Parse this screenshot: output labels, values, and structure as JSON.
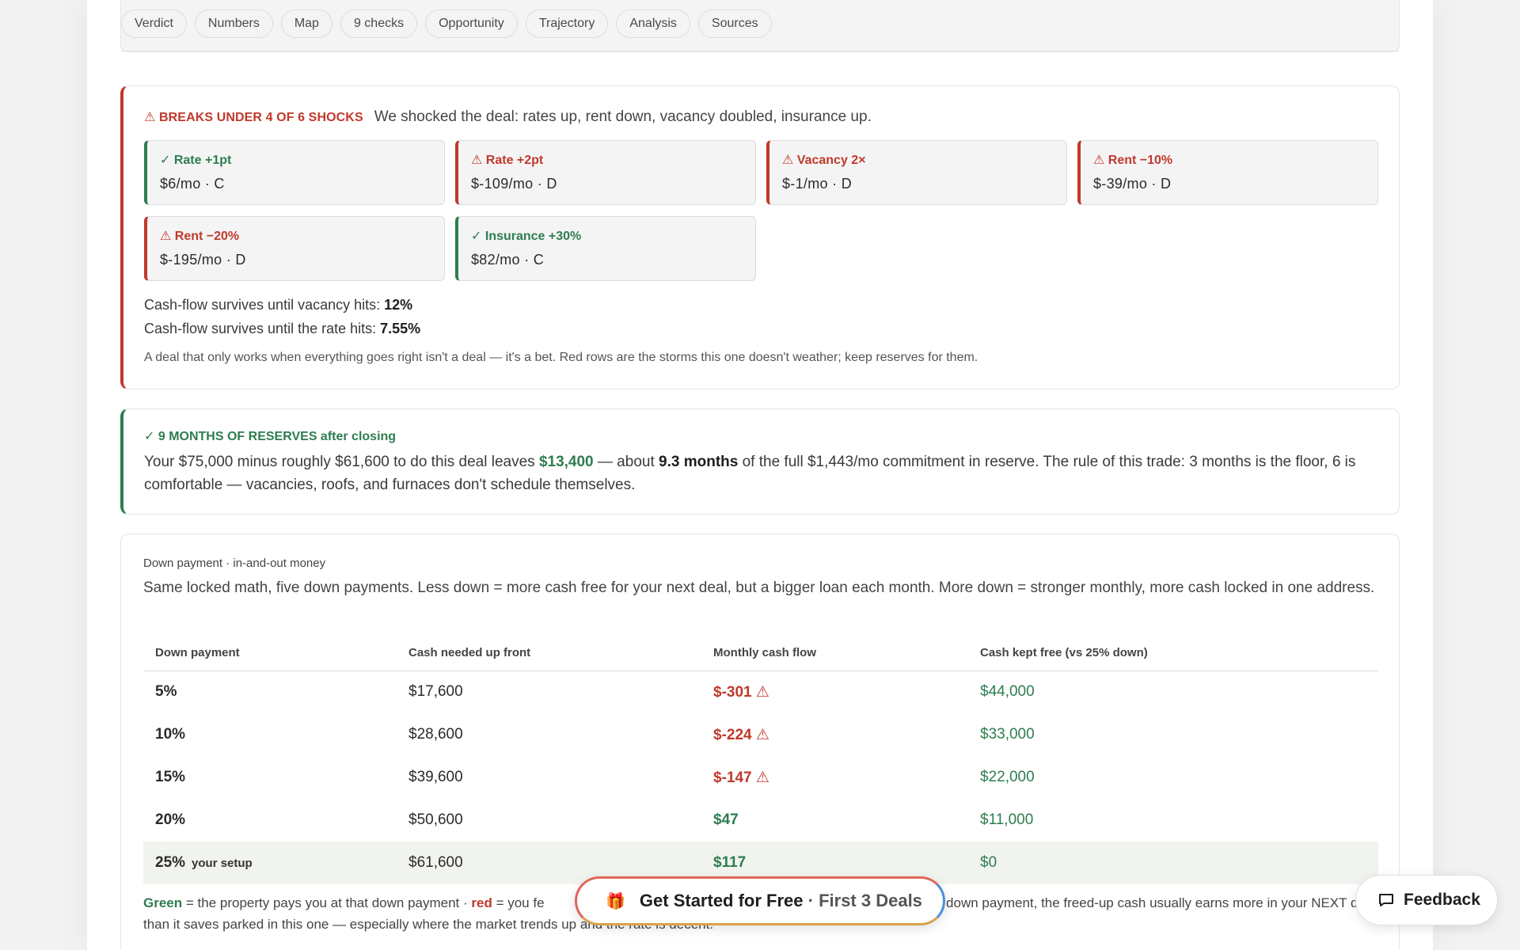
{
  "nav": {
    "pills": [
      "Verdict",
      "Numbers",
      "Map",
      "9 checks",
      "Opportunity",
      "Trajectory",
      "Analysis",
      "Sources"
    ]
  },
  "shocks": {
    "tag": "⚠ BREAKS UNDER 4 OF 6 SHOCKS",
    "lead": "We shocked the deal: rates up, rent down, vacancy doubled, insurance up.",
    "tiles": [
      {
        "label": "✓ Rate +1pt",
        "value": "$6/mo · C",
        "status": "ok"
      },
      {
        "label": "⚠ Rate +2pt",
        "value": "$-109/mo · D",
        "status": "bad"
      },
      {
        "label": "⚠ Vacancy 2×",
        "value": "$-1/mo · D",
        "status": "bad"
      },
      {
        "label": "⚠ Rent −10%",
        "value": "$-39/mo · D",
        "status": "bad"
      },
      {
        "label": "⚠ Rent −20%",
        "value": "$-195/mo · D",
        "status": "bad"
      },
      {
        "label": "✓ Insurance +30%",
        "value": "$82/mo · C",
        "status": "ok"
      }
    ],
    "survive_vacancy_label": "Cash-flow survives until vacancy hits:",
    "survive_vacancy_value": "12%",
    "survive_rate_label": "Cash-flow survives until the rate hits:",
    "survive_rate_value": "7.55%",
    "note": "A deal that only works when everything goes right isn't a deal — it's a bet. Red rows are the storms this one doesn't weather; keep reserves for them."
  },
  "reserves": {
    "tag": "✓ 9 MONTHS OF RESERVES after closing",
    "text_1": "Your $75,000 minus roughly $61,600 to do this deal leaves ",
    "amount": "$13,400",
    "text_2": " — about ",
    "months": "9.3 months",
    "text_3": " of the full $1,443/mo commitment in reserve. The rule of this trade: 3 months is the floor, 6 is comfortable — vacancies, roofs, and furnaces don't schedule themselves."
  },
  "down_payment": {
    "kicker": "Down payment · in-and-out money",
    "lead": "Same locked math, five down payments. Less down = more cash free for your next deal, but a bigger loan each month. More down = stronger monthly, more cash locked in one address.",
    "headers": [
      "Down payment",
      "Cash needed up front",
      "Monthly cash flow",
      "Cash kept free (vs 25% down)"
    ],
    "rows": [
      {
        "pct": "5%",
        "cash": "$17,600",
        "flow": "$-301 ⚠",
        "free": "$44,000",
        "neg": true
      },
      {
        "pct": "10%",
        "cash": "$28,600",
        "flow": "$-224 ⚠",
        "free": "$33,000",
        "neg": true
      },
      {
        "pct": "15%",
        "cash": "$39,600",
        "flow": "$-147 ⚠",
        "free": "$22,000",
        "neg": true
      },
      {
        "pct": "20%",
        "cash": "$50,600",
        "flow": "$47",
        "free": "$11,000",
        "neg": false
      },
      {
        "pct": "25%",
        "cash": "$61,600",
        "flow": "$117",
        "free": "$0",
        "neg": false,
        "setup": "your setup"
      }
    ],
    "legend_green": "Green",
    "legend_1": " = the property pays you at that down payment · ",
    "legend_red": "red",
    "legend_2": " = you fe",
    "legend_3": "a lower down payment, the freed-up cash usually earns more in your NEXT deal than it saves parked in this one — especially where the market trends up and the rate is decent."
  },
  "cta": {
    "icon": "gift-icon",
    "main": "Get Started for Free",
    "sub": "· First 3 Deals"
  },
  "feedback": {
    "label": "Feedback",
    "icon": "chat-bubble-icon"
  },
  "colors": {
    "red": "#c0392b",
    "green": "#2e7d4f"
  }
}
